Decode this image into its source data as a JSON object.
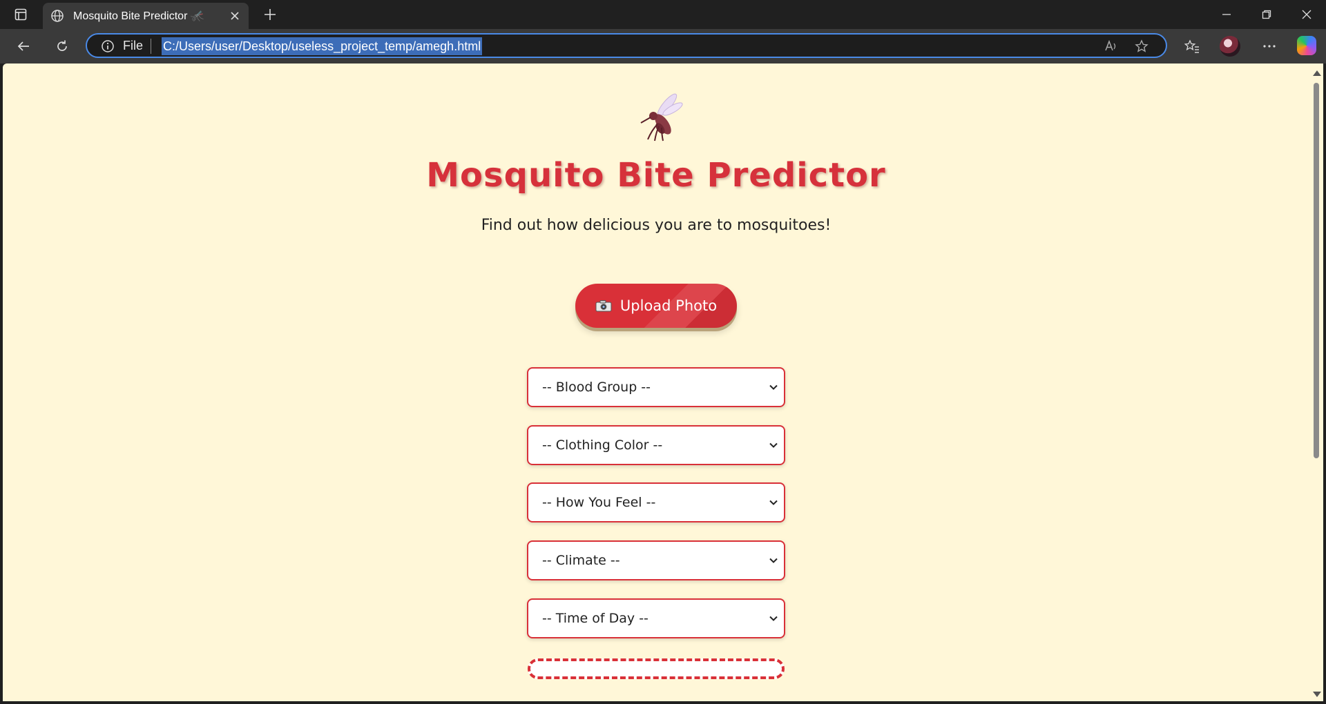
{
  "browser": {
    "tab_title": "Mosquito Bite Predictor 🦟",
    "address_scheme": "File",
    "url": "C:/Users/user/Desktop/useless_project_temp/amegh.html"
  },
  "page": {
    "mascot": "🦟",
    "title": "Mosquito Bite Predictor",
    "subtitle": "Find out how delicious you are to mosquitoes!",
    "upload_icon": "📷",
    "upload_label": "Upload Photo",
    "selects": {
      "blood_group": "-- Blood Group --",
      "clothing_color": "-- Clothing Color --",
      "how_you_feel": "-- How You Feel --",
      "climate": "-- Climate --",
      "time_of_day": "-- Time of Day --"
    }
  },
  "colors": {
    "accent_red": "#d93038",
    "page_background": "#fff7d8",
    "chrome_dark": "#202020"
  }
}
